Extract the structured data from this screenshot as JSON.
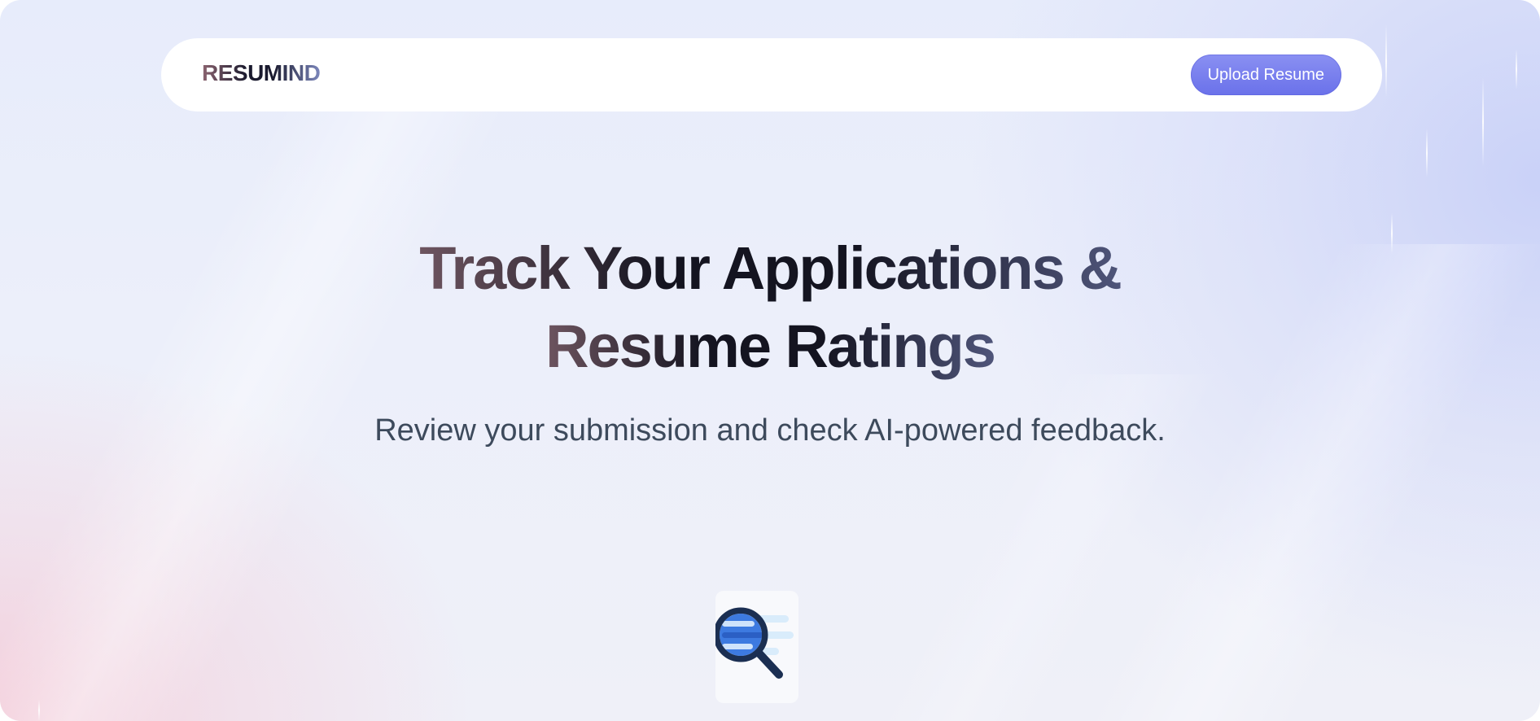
{
  "navbar": {
    "logo_text": "RESUMIND",
    "upload_button_label": "Upload Resume"
  },
  "hero": {
    "title_line1": "Track Your Applications &",
    "title_line2": "Resume Ratings",
    "subtitle": "Review your submission and check AI-powered feedback."
  },
  "illustration": {
    "icon": "resume-scan-icon"
  },
  "colors": {
    "accent": "#6a71ea",
    "subtitle_text": "#3d4a5c",
    "navbar_bg": "#ffffff"
  }
}
